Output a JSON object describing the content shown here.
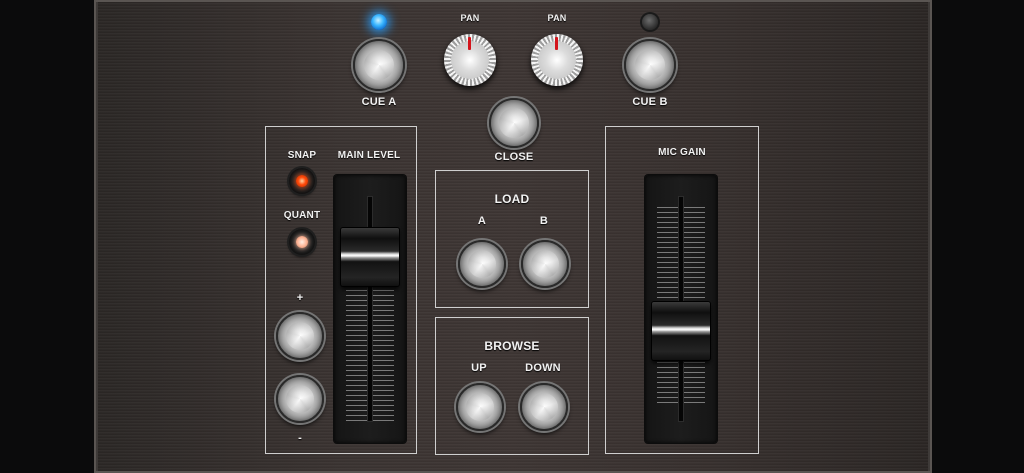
{
  "top": {
    "cue_a_label": "CUE A",
    "cue_b_label": "CUE B",
    "pan_left_label": "PAN",
    "pan_right_label": "PAN",
    "close_label": "CLOSE",
    "cue_a_led": "on",
    "cue_b_led": "off"
  },
  "left_section": {
    "snap_label": "SNAP",
    "quant_label": "QUANT",
    "snap_color": "#ff4a0a",
    "quant_color": "#ffb89a",
    "plus_label": "+",
    "minus_label": "-",
    "main_level_label": "MAIN LEVEL",
    "main_level_value": 0.78
  },
  "load": {
    "title": "LOAD",
    "a_label": "A",
    "b_label": "B"
  },
  "browse": {
    "title": "BROWSE",
    "up_label": "UP",
    "down_label": "DOWN"
  },
  "mic": {
    "title": "MIC GAIN",
    "gain_value": 0.38
  },
  "colors": {
    "led_blue": "#3ab6ff",
    "pan_indicator": "#d4141c",
    "panel_border": "#cfcfcf"
  }
}
